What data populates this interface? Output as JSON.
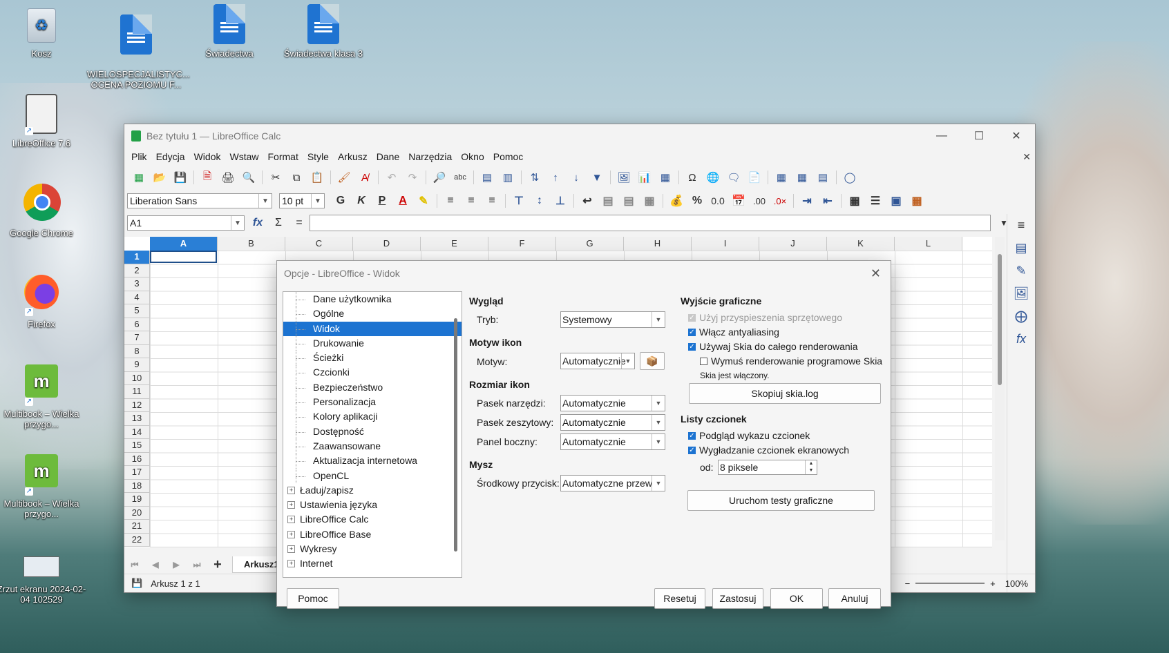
{
  "desktop": {
    "icons": [
      {
        "label": "Kosz"
      },
      {
        "label": "WIELOSPECJALISTYC...\nOCENA POZIOMU F..."
      },
      {
        "label": "Świadectwa"
      },
      {
        "label": "Świadectwa klasa 3"
      },
      {
        "label": "LibreOffice 7.6"
      },
      {
        "label": "Google Chrome"
      },
      {
        "label": "Firefox"
      },
      {
        "label": "Multibook – Wielka przygo..."
      },
      {
        "label": "Multibook – Wielka przygo..."
      },
      {
        "label": "Zrzut ekranu 2024-02-04 102529"
      }
    ]
  },
  "window": {
    "title": "Bez tytułu 1 — LibreOffice Calc",
    "menu": [
      "Plik",
      "Edycja",
      "Widok",
      "Wstaw",
      "Format",
      "Style",
      "Arkusz",
      "Dane",
      "Narzędzia",
      "Okno",
      "Pomoc"
    ],
    "font_name": "Liberation Sans",
    "font_size": "10 pt",
    "cell_ref": "A1",
    "formula_value": "",
    "columns": [
      "A",
      "B",
      "C",
      "D",
      "E",
      "F",
      "G",
      "H",
      "I",
      "J",
      "K",
      "L"
    ],
    "rows": [
      "1",
      "2",
      "3",
      "4",
      "5",
      "6",
      "7",
      "8",
      "9",
      "10",
      "11",
      "12",
      "13",
      "14",
      "15",
      "16",
      "17",
      "18",
      "19",
      "20",
      "21",
      "22"
    ],
    "sheet_tab": "Arkusz1",
    "status_sheet": "Arkusz 1 z 1",
    "zoom": "100%"
  },
  "dialog": {
    "title": "Opcje - LibreOffice - Widok",
    "tree": [
      {
        "label": "Dane użytkownika",
        "type": "child"
      },
      {
        "label": "Ogólne",
        "type": "child"
      },
      {
        "label": "Widok",
        "type": "child",
        "selected": true
      },
      {
        "label": "Drukowanie",
        "type": "child"
      },
      {
        "label": "Ścieżki",
        "type": "child"
      },
      {
        "label": "Czcionki",
        "type": "child"
      },
      {
        "label": "Bezpieczeństwo",
        "type": "child"
      },
      {
        "label": "Personalizacja",
        "type": "child"
      },
      {
        "label": "Kolory aplikacji",
        "type": "child"
      },
      {
        "label": "Dostępność",
        "type": "child"
      },
      {
        "label": "Zaawansowane",
        "type": "child"
      },
      {
        "label": "Aktualizacja internetowa",
        "type": "child"
      },
      {
        "label": "OpenCL",
        "type": "child"
      },
      {
        "label": "Ładuj/zapisz",
        "type": "top"
      },
      {
        "label": "Ustawienia języka",
        "type": "top"
      },
      {
        "label": "LibreOffice Calc",
        "type": "top"
      },
      {
        "label": "LibreOffice Base",
        "type": "top"
      },
      {
        "label": "Wykresy",
        "type": "top"
      },
      {
        "label": "Internet",
        "type": "top"
      }
    ],
    "wyglad": {
      "heading": "Wygląd",
      "tryb_label": "Tryb:",
      "tryb_value": "Systemowy"
    },
    "motyw_ikon": {
      "heading": "Motyw ikon",
      "label": "Motyw:",
      "value": "Automatycznie"
    },
    "rozmiar_ikon": {
      "heading": "Rozmiar ikon",
      "pasek_narzedzi_label": "Pasek narzędzi:",
      "pasek_narzedzi_value": "Automatycznie",
      "pasek_zeszytowy_label": "Pasek zeszytowy:",
      "pasek_zeszytowy_value": "Automatycznie",
      "panel_boczny_label": "Panel boczny:",
      "panel_boczny_value": "Automatycznie"
    },
    "mysz": {
      "heading": "Mysz",
      "label": "Środkowy przycisk:",
      "value": "Automatyczne przew"
    },
    "wyjscie": {
      "heading": "Wyjście graficzne",
      "hw_accel": "Użyj przyspieszenia sprzętowego",
      "antialias": "Włącz antyaliasing",
      "skia": "Używaj Skia do całego renderowania",
      "skia_soft": "Wymuś renderowanie programowe Skia",
      "skia_status": "Skia jest włączony.",
      "copy_btn": "Skopiuj skia.log"
    },
    "listy": {
      "heading": "Listy czcionek",
      "preview": "Podgląd wykazu czcionek",
      "smoothing": "Wygładzanie czcionek ekranowych",
      "od_label": "od:",
      "od_value": "8 piksele"
    },
    "test_btn": "Uruchom testy graficzne",
    "buttons": {
      "help": "Pomoc",
      "reset": "Resetuj",
      "apply": "Zastosuj",
      "ok": "OK",
      "cancel": "Anuluj"
    }
  }
}
